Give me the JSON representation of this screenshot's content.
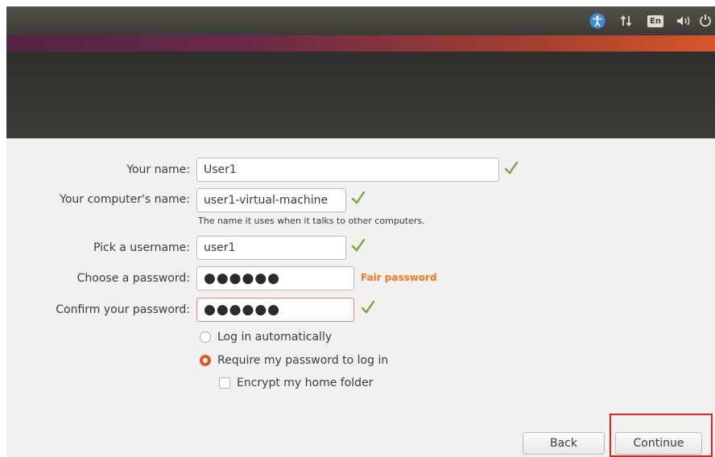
{
  "topbar": {
    "keyboard_layout": "En",
    "icons": [
      "accessibility-icon",
      "network-icon",
      "keyboard-layout-icon",
      "volume-icon",
      "power-icon"
    ]
  },
  "form": {
    "your_name": {
      "label": "Your name:",
      "value": "User1"
    },
    "computer_name": {
      "label": "Your computer's name:",
      "value": "user1-virtual-machine",
      "hint": "The name it uses when it talks to other computers."
    },
    "username": {
      "label": "Pick a username:",
      "value": "user1"
    },
    "password": {
      "label": "Choose a password:",
      "value": "●●●●●●",
      "strength": "Fair password"
    },
    "confirm_password": {
      "label": "Confirm your password:",
      "value": "●●●●●●"
    },
    "login_options": [
      {
        "label": "Log in automatically",
        "selected": false
      },
      {
        "label": "Require my password to log in",
        "selected": true
      }
    ],
    "encrypt": {
      "label": "Encrypt my home folder",
      "checked": false
    }
  },
  "buttons": {
    "back": "Back",
    "continue": "Continue"
  },
  "colors": {
    "accent": "#e95420",
    "check": "#73a939",
    "strength": "#f47421",
    "highlight": "#e8201c"
  }
}
